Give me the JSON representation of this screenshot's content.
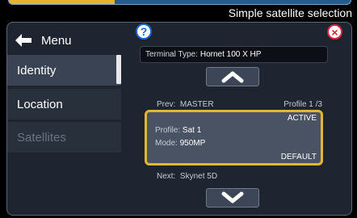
{
  "top_progress": 0.31,
  "caption": "Simple satellite selection",
  "sidebar": {
    "menu_label": "Menu",
    "items": [
      {
        "label": "Identity"
      },
      {
        "label": "Location"
      },
      {
        "label": "Satellites"
      }
    ]
  },
  "header": {
    "help_icon": "?",
    "close_icon": "×"
  },
  "terminal": {
    "label": "Terminal Type:",
    "value": "Hornet 100 X HP"
  },
  "profiles": {
    "prev_label": "Prev:",
    "prev_value": "MASTER",
    "counter": "Profile 1 /3",
    "current": {
      "status": "ACTIVE",
      "profile_label": "Profile:",
      "profile_value": "Sat 1",
      "mode_label": "Mode:",
      "mode_value": "950MP",
      "badge": "DEFAULT"
    },
    "next_label": "Next:",
    "next_value": "Skynet 5D"
  },
  "colors": {
    "accent": "#e3b62b",
    "help": "#1766c8",
    "close": "#d9233a"
  }
}
